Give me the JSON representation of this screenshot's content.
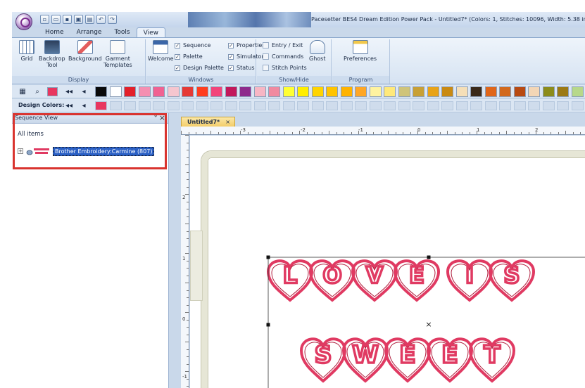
{
  "window": {
    "title": "Pacesetter BES4 Dream Edition Power Pack - Untitled7* (Colors: 1, Stitches: 10096, Width: 5.38 in, Height:"
  },
  "tabs": [
    {
      "label": "Home"
    },
    {
      "label": "Arrange"
    },
    {
      "label": "Tools"
    },
    {
      "label": "View"
    }
  ],
  "ribbon": {
    "display": {
      "group_label": "Display",
      "grid": "Grid",
      "backdrop_line1": "Backdrop",
      "backdrop_line2": "Tool",
      "background": "Background",
      "garment_line1": "Garment",
      "garment_line2": "Templates"
    },
    "windows": {
      "group_label": "Windows",
      "welcome": "Welcome",
      "sequence": "Sequence",
      "palette": "Palette",
      "design_palette": "Design Palette",
      "properties": "Properties",
      "simulator": "Simulator",
      "status": "Status",
      "check_mark": "✓"
    },
    "show_hide": {
      "group_label": "Show/Hide",
      "entry_exit": "Entry / Exit",
      "commands": "Commands",
      "stitch_points": "Stitch Points",
      "ghost": "Ghost"
    },
    "program_preferences": {
      "group_label": "Program Preferences",
      "preferences": "Preferences"
    }
  },
  "palette": {
    "design_colors_label": "Design Colors:",
    "design_color": "#e8365f",
    "current_color": "#e8365f",
    "swatches": [
      "#0a0a0a",
      "#ffffff",
      "#e3202a",
      "#f48fb1",
      "#f06292",
      "#f5c6cf",
      "#e53935",
      "#ff3d1f",
      "#f2447a",
      "#c2185b",
      "#8e2a8c",
      "#f7b6c4",
      "#f08aa0",
      "#ffff33",
      "#ffee00",
      "#ffd400",
      "#ffc400",
      "#ffb300",
      "#ffa726",
      "#fff3a0",
      "#ffe97a",
      "#cfc47a",
      "#c8a035",
      "#e8a317",
      "#c98a12",
      "#f5dfb8",
      "#3a2a1a",
      "#e0661a",
      "#d2691e",
      "#b84a12",
      "#f3d6b6",
      "#8c8c1a",
      "#9c7a14",
      "#b7d88a",
      "#e8f0d8"
    ]
  },
  "sequence_view": {
    "title": "Sequence View",
    "pin": "ᵠ",
    "close": "×",
    "all_items": "All items",
    "expand": "+",
    "item_label": "Brother Embroidery:Carmine (807)"
  },
  "document": {
    "tab_label": "Untitled7*",
    "tab_close": "×",
    "hruler_labels": [
      "-3",
      "-2",
      "-1",
      "0",
      "1",
      "2"
    ],
    "vruler_labels": [
      "2",
      "1",
      "0",
      "-1"
    ],
    "design_text_line1": "LOVE IS",
    "design_text_line2": "SWEET",
    "thread_color": "#e03a62",
    "thread_color_dark": "#b0203f"
  }
}
